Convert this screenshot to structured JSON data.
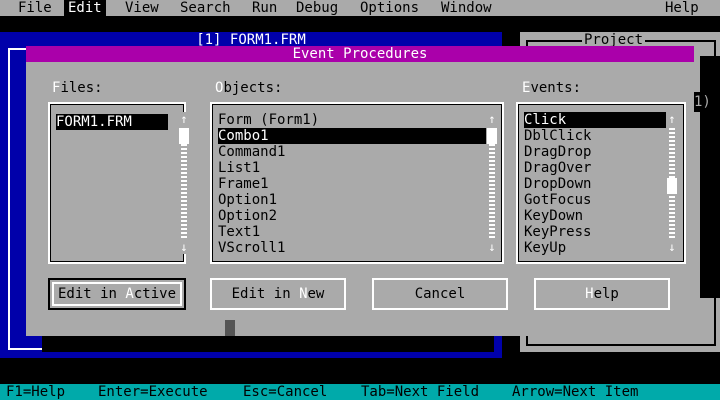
{
  "menubar": {
    "items": [
      {
        "label": "File",
        "active": false
      },
      {
        "label": "Edit",
        "active": true
      },
      {
        "label": "View",
        "active": false
      },
      {
        "label": "Search",
        "active": false
      },
      {
        "label": "Run",
        "active": false
      },
      {
        "label": "Debug",
        "active": false
      },
      {
        "label": "Options",
        "active": false
      },
      {
        "label": "Window",
        "active": false
      }
    ],
    "help": "Help"
  },
  "form_window": {
    "title": "[1] FORM1.FRM"
  },
  "project_window": {
    "title": "Project",
    "partial_text": "1)"
  },
  "dialog": {
    "title": "Event Procedures",
    "files": {
      "label_hot": "F",
      "label_rest": "iles:",
      "items": [
        "FORM1.FRM"
      ],
      "selected_index": 0
    },
    "objects": {
      "label_hot": "O",
      "label_rest": "bjects:",
      "items": [
        "Form (Form1)",
        "Combo1",
        "Command1",
        "List1",
        "Frame1",
        "Option1",
        "Option2",
        "Text1",
        "VScroll1"
      ],
      "selected_index": 1
    },
    "events": {
      "label_hot": "E",
      "label_rest": "vents:",
      "items": [
        "Click",
        "DblClick",
        "DragDrop",
        "DragOver",
        "DropDown",
        "GotFocus",
        "KeyDown",
        "KeyPress",
        "KeyUp"
      ],
      "selected_index": 0
    },
    "buttons": {
      "edit_active_pre": "Edit in ",
      "edit_active_hot": "A",
      "edit_active_post": "ctive",
      "edit_new_pre": "Edit in ",
      "edit_new_hot": "N",
      "edit_new_post": "ew",
      "cancel": "Cancel",
      "help_hot": "H",
      "help_rest": "elp"
    }
  },
  "statusbar": {
    "items": [
      "F1=Help",
      "Enter=Execute",
      "Esc=Cancel",
      "Tab=Next Field",
      "Arrow=Next Item"
    ]
  },
  "colors": {
    "menu_bg": "#aaaaaa",
    "dialog_title_bg": "#aa00aa",
    "form_window_bg": "#0000aa",
    "status_bg": "#00aaaa"
  }
}
